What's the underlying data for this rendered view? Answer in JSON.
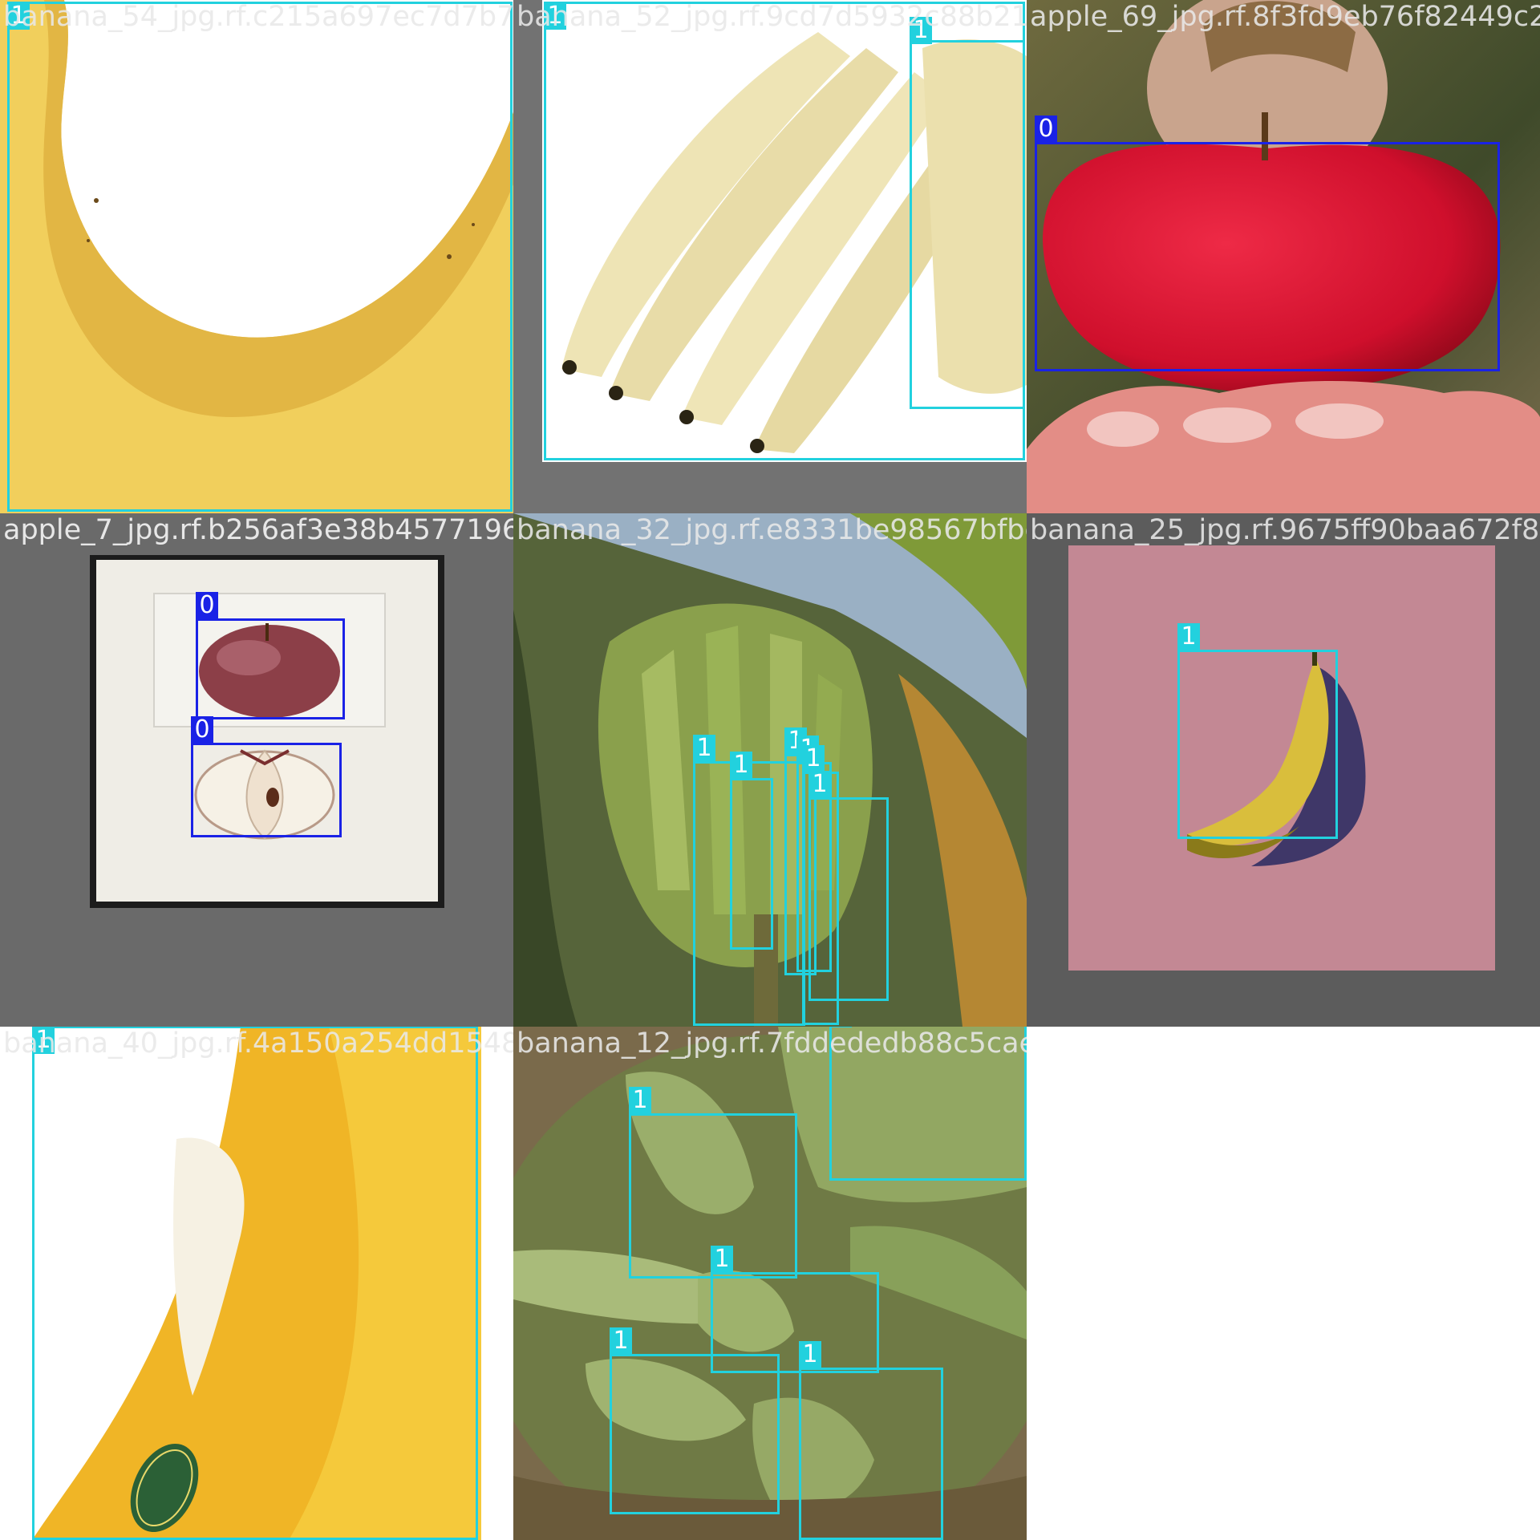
{
  "grid": {
    "background": "#ffffff",
    "classes": {
      "0": {
        "color": "#1a22e6"
      },
      "1": {
        "color": "#22d1de"
      }
    }
  },
  "tiles": [
    {
      "filename": "banana_54_jpg.rf.c215a697ec7d7b77ba",
      "boxes": [
        {
          "cls": "1"
        }
      ]
    },
    {
      "filename": "banana_52_jpg.rf.9cd7d5932c88b21a",
      "boxes": [
        {
          "cls": "1"
        },
        {
          "cls": "1"
        }
      ]
    },
    {
      "filename": "apple_69_jpg.rf.8f3fd9eb76f82449c27",
      "boxes": [
        {
          "cls": "0"
        }
      ]
    },
    {
      "filename": "apple_7_jpg.rf.b256af3e38b45771967a4d",
      "boxes": [
        {
          "cls": "0"
        },
        {
          "cls": "0"
        }
      ]
    },
    {
      "filename": "banana_32_jpg.rf.e8331be98567bfbe4a",
      "boxes": [
        {
          "cls": "1"
        },
        {
          "cls": "1"
        },
        {
          "cls": "1"
        },
        {
          "cls": "1"
        },
        {
          "cls": "1"
        },
        {
          "cls": "1"
        }
      ]
    },
    {
      "filename": "banana_25_jpg.rf.9675ff90baa672f8e",
      "boxes": [
        {
          "cls": "1"
        }
      ]
    },
    {
      "filename": "banana_40_jpg.rf.4a150a254dd1548e0a7e58",
      "boxes": [
        {
          "cls": "1"
        }
      ]
    },
    {
      "filename": "banana_12_jpg.rf.7fddededb88c5cae20e9232",
      "boxes": [
        {
          "cls": "1"
        },
        {
          "cls": "1"
        },
        {
          "cls": "1"
        },
        {
          "cls": "1"
        },
        {
          "cls": "1"
        }
      ]
    }
  ]
}
